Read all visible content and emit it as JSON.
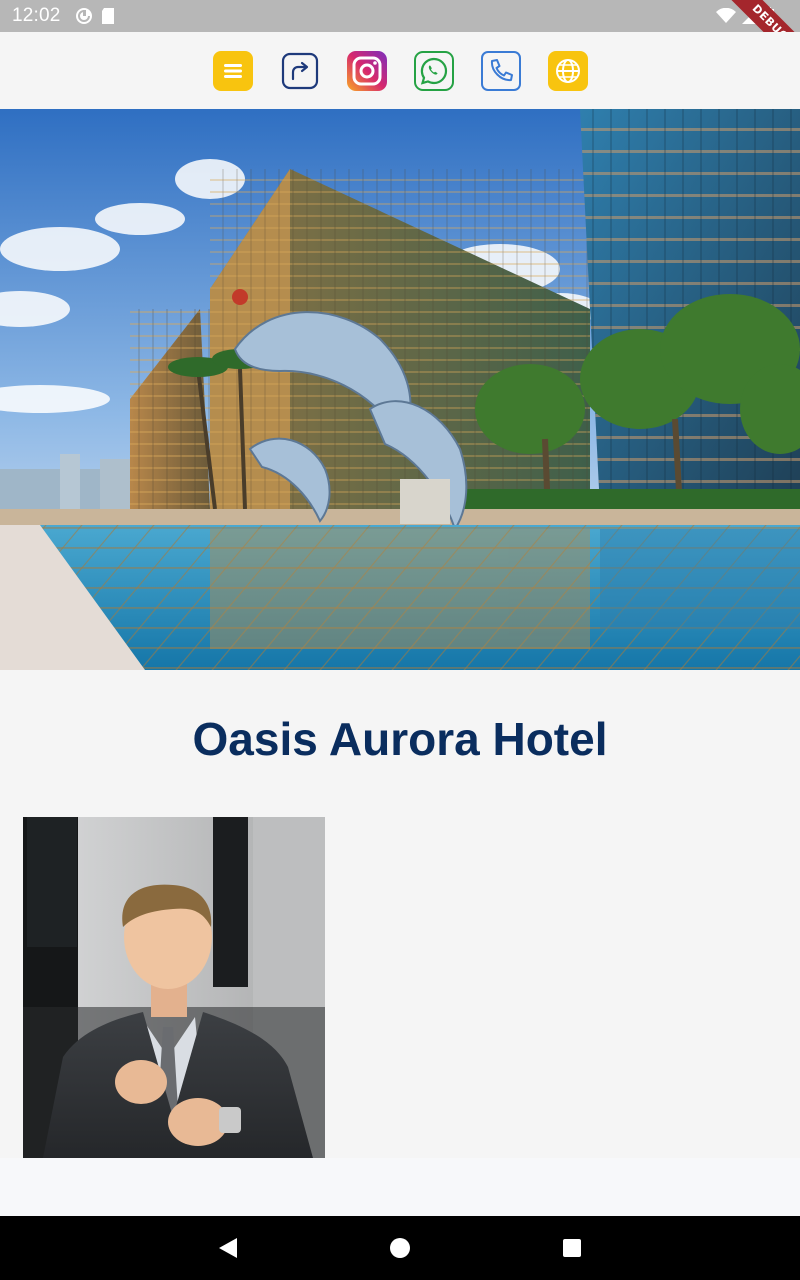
{
  "status_bar": {
    "time": "12:02",
    "icons": [
      "sync-icon",
      "sd-card-icon",
      "wifi-icon",
      "signal-icon",
      "battery-icon"
    ],
    "debug_label": "DEBUG"
  },
  "top_icons": [
    {
      "name": "menu-icon",
      "color": "#f5c518"
    },
    {
      "name": "share-icon",
      "color": "#1e3a7b"
    },
    {
      "name": "instagram-icon",
      "color": "#c13584"
    },
    {
      "name": "whatsapp-icon",
      "color": "#25a244"
    },
    {
      "name": "phone-icon",
      "color": "#3a7bd5"
    },
    {
      "name": "globe-icon",
      "color": "#f5c518"
    }
  ],
  "hero": {
    "subject": "hotel-exterior-photo"
  },
  "hotel": {
    "name": "Oasis Aurora Hotel",
    "title_color": "#0a2d5e"
  },
  "staff_photo": {
    "subject": "staff-portrait-photo"
  },
  "nav": {
    "buttons": [
      "back-icon",
      "home-icon",
      "recents-icon"
    ]
  }
}
